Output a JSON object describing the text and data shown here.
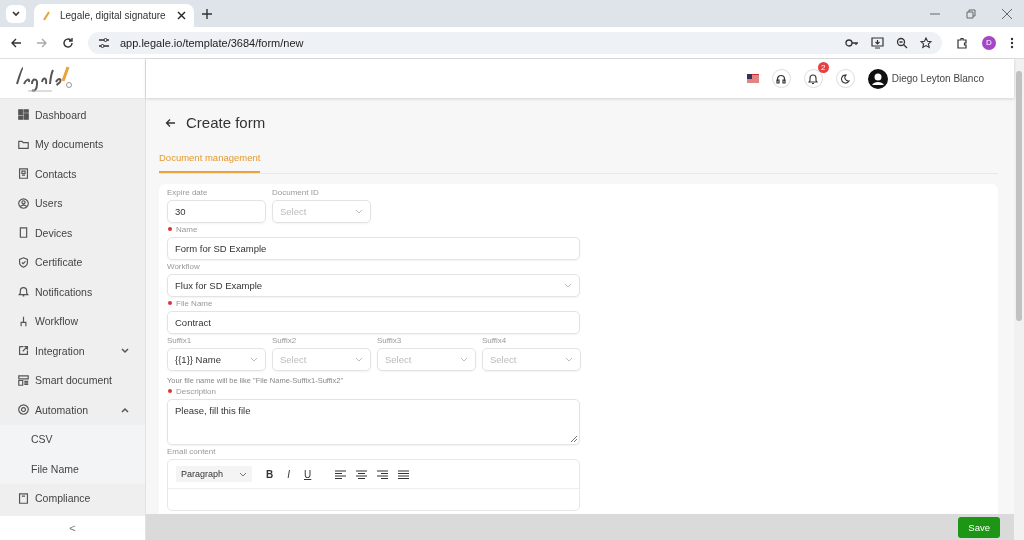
{
  "browser": {
    "tab_title": "Legale, digital signature",
    "url": "app.legale.io/template/3684/form/new",
    "profile_initial": "D"
  },
  "header": {
    "notification_count": "2",
    "user_name": "Diego Leyton Blanco"
  },
  "sidebar": {
    "items": [
      {
        "label": "Dashboard",
        "selected": false
      },
      {
        "label": "My documents",
        "selected": false
      },
      {
        "label": "Contacts",
        "selected": false
      },
      {
        "label": "Users",
        "selected": false
      },
      {
        "label": "Devices",
        "selected": false
      },
      {
        "label": "Certificate",
        "selected": false
      },
      {
        "label": "Notifications",
        "selected": false
      },
      {
        "label": "Workflow",
        "selected": false
      },
      {
        "label": "Integration",
        "selected": false,
        "expanded": false
      },
      {
        "label": "Smart document",
        "selected": false
      },
      {
        "label": "Automation",
        "selected": false,
        "expanded": true,
        "children": [
          {
            "label": "CSV",
            "selected": false
          },
          {
            "label": "File Name",
            "selected": false
          }
        ]
      },
      {
        "label": "Compliance",
        "selected": false
      }
    ],
    "collapse": "<"
  },
  "page": {
    "title": "Create form",
    "tabs": [
      {
        "label": "Document management",
        "selected": true
      }
    ]
  },
  "form": {
    "expire_date": {
      "label": "Expire date",
      "value": "30"
    },
    "document_id": {
      "label": "Document ID",
      "placeholder": "Select"
    },
    "name": {
      "label": "Name",
      "required": true,
      "value": "Form for SD Example"
    },
    "workflow": {
      "label": "Workflow",
      "value": "Flux for SD Example"
    },
    "file_name": {
      "label": "File Name",
      "required": true,
      "value": "Contract"
    },
    "suffixes": [
      {
        "label": "Suffix1",
        "value": "{{1}} Name"
      },
      {
        "label": "Suffix2",
        "placeholder": "Select"
      },
      {
        "label": "Suffix3",
        "placeholder": "Select"
      },
      {
        "label": "Suffix4",
        "placeholder": "Select"
      }
    ],
    "hint": "Your file name will be like \"File Name-Suffix1-Suffix2\"",
    "description": {
      "label": "Description",
      "required": true,
      "value": "Please, fill this file"
    },
    "email_content": {
      "label": "Email content",
      "block_style": "Paragraph",
      "format_buttons": [
        "B",
        "I",
        "U"
      ]
    }
  },
  "footer": {
    "save": "Save"
  }
}
